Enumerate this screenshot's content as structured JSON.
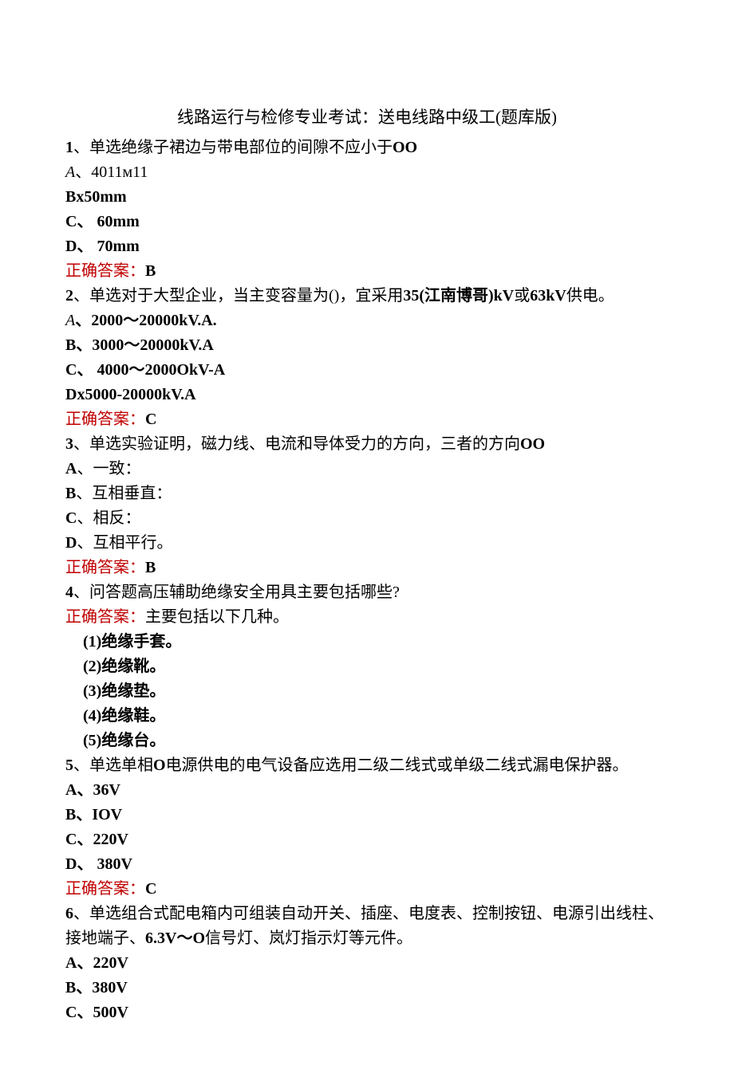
{
  "title": "线路运行与检修专业考试：送电线路中级工(题库版)",
  "ans_label": "正确答案：",
  "q1": {
    "stem": "、单选绝缘子裙边与带电部位的间隙不应小于",
    "num": "1",
    "tail": "OO",
    "optA_pre": "A",
    "optA_sep": "、",
    "optA_val": "4011м11",
    "optB": "Bx50mm",
    "optC": "C、 60mm",
    "optD": "D、 70mm",
    "ans": "B"
  },
  "q2": {
    "num": "2",
    "stem": "、单选对于大型企业，当主变容量为()，宜采用",
    "mid": "35(江南博哥)",
    "tail1": "kV",
    "tail2": "或",
    "tail3": "63kV",
    "tail4": "供电。",
    "optA_pre": "A",
    "optA_val": "、2000〜20000kV.A.",
    "optB": "B、3000〜20000kV.A",
    "optC": "C、 4000〜2000OkV-A",
    "optD": "Dx5000-20000kV.A",
    "ans": "C"
  },
  "q3": {
    "num": "3",
    "stem": "、单选实验证明，磁力线、电流和导体受力的方向，三者的方向",
    "tail": "OO",
    "optA": "A",
    "optA_txt": "、一致：",
    "optB": "B",
    "optB_txt": "、互相垂直：",
    "optC": "C",
    "optC_txt": "、相反：",
    "optD": "D",
    "optD_txt": "、互相平行。",
    "ans": "B"
  },
  "q4": {
    "num": "4",
    "stem": "、问答题高压辅助绝缘安全用具主要包括哪些?",
    "ans_text": "主要包括以下几种。",
    "items": [
      "(1)绝缘手套。",
      "(2)绝缘靴。",
      "(3)绝缘垫。",
      "(4)绝缘鞋。",
      "(5)绝缘台。"
    ]
  },
  "q5": {
    "num": "5",
    "stem_a": "、单选单相",
    "stem_b": "O",
    "stem_c": "电源供电的电气设备应选用二级二线式或单级二线式漏电保护器。",
    "optA": "A、36V",
    "optB": "B、IOV",
    "optC": "C、220V",
    "optD": "D、 380V",
    "ans": "C"
  },
  "q6": {
    "num": "6",
    "stem_a": "、单选组合式配电箱内可组装自动开关、插座、电度表、控制按钮、电源引出线柱、",
    "stem_b": "接地端子、",
    "stem_c": "6.3V〜O",
    "stem_d": "信号灯、岚灯指示灯等元件。",
    "optA": "A、220V",
    "optB": "B、380V",
    "optC": "C、500V"
  }
}
